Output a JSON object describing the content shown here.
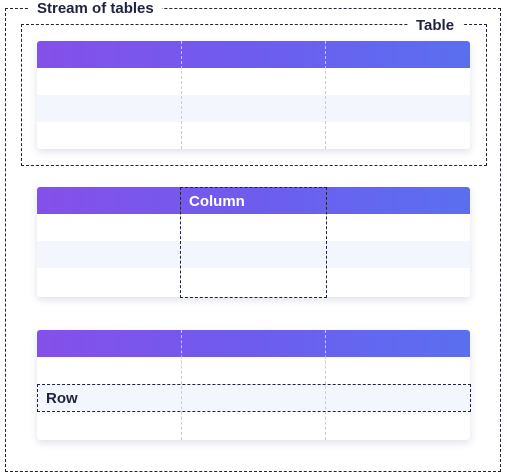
{
  "stream": {
    "label": "Stream of tables"
  },
  "table_frame": {
    "label": "Table"
  },
  "column_highlight": {
    "label": "Column"
  },
  "row_highlight": {
    "label": "Row"
  },
  "colors": {
    "header_gradient": [
      "#8550ea",
      "#5a6ff0"
    ],
    "dashed_border": "#1f2340",
    "alt_row": "#f3f6fd"
  },
  "tables": [
    {
      "columns": 3,
      "body_rows": 3
    },
    {
      "columns": 3,
      "body_rows": 3
    },
    {
      "columns": 3,
      "body_rows": 3
    }
  ]
}
